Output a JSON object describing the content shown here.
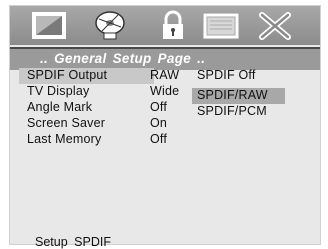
{
  "toolbar": {
    "icons": [
      "tv-icon",
      "disc-icon",
      "lock-icon",
      "preference-icon",
      "exit-icon"
    ]
  },
  "page_title": ".. General  Setup  Page ..",
  "menu": [
    {
      "label": "SPDIF  Output",
      "value": "RAW"
    },
    {
      "label": "TV  Display",
      "value": "Wide"
    },
    {
      "label": "Angle  Mark",
      "value": "Off"
    },
    {
      "label": "Screen  Saver",
      "value": "On"
    },
    {
      "label": "Last  Memory",
      "value": "Off"
    }
  ],
  "submenu": [
    "SPDIF  Off",
    "SPDIF/RAW",
    "SPDIF/PCM"
  ],
  "submenu_selected": "SPDIF/RAW",
  "status": "Setup  SPDIF",
  "colors": {
    "icon_bar": "#9a9a9a",
    "title_bar": "#9a9a9a",
    "row_highlight": "#c8c8c8",
    "submenu_highlight": "#a8a8a8",
    "panel": "#e8e8e8"
  }
}
